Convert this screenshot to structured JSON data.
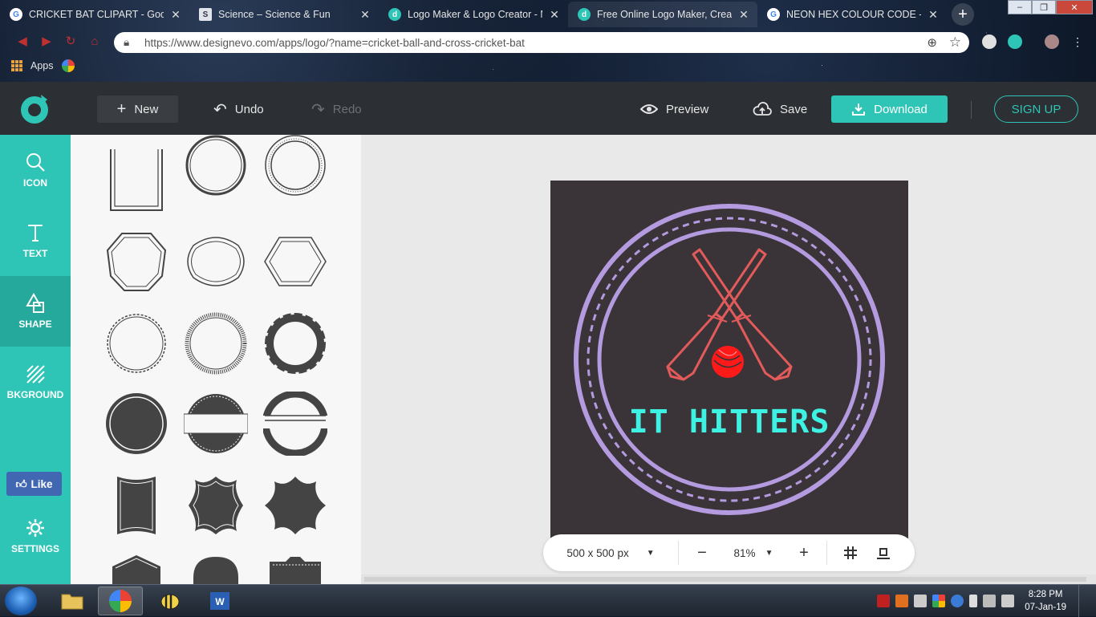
{
  "browser": {
    "tabs": [
      {
        "title": "CRICKET BAT CLIPART - Google",
        "favicon": "google-icon"
      },
      {
        "title": "Science – Science & Fun",
        "favicon": "science-icon"
      },
      {
        "title": "Logo Maker & Logo Creator - M",
        "favicon": "designevo-icon"
      },
      {
        "title": "Free Online Logo Maker, Create",
        "favicon": "designevo-icon"
      },
      {
        "title": "NEON HEX COLOUR CODE - Go",
        "favicon": "google-icon"
      }
    ],
    "url": "https://www.designevo.com/apps/logo/?name=cricket-ball-and-cross-cricket-bat",
    "bookmarks": {
      "apps_label": "Apps"
    }
  },
  "toolbar": {
    "new_label": "New",
    "undo_label": "Undo",
    "redo_label": "Redo",
    "preview_label": "Preview",
    "save_label": "Save",
    "download_label": "Download",
    "signup_label": "SIGN UP"
  },
  "sidebar": {
    "items": [
      {
        "label": "ICON",
        "icon": "search-icon"
      },
      {
        "label": "TEXT",
        "icon": "text-icon"
      },
      {
        "label": "SHAPE",
        "icon": "shape-icon"
      },
      {
        "label": "BKGROUND",
        "icon": "background-icon"
      },
      {
        "label": "SETTINGS",
        "icon": "gear-icon"
      }
    ],
    "active": "SHAPE",
    "like_label": "Like"
  },
  "canvas": {
    "logo_text": "IT HITTERS",
    "size_label": "500 x 500 px",
    "zoom_label": "81%",
    "colors": {
      "background": "#3a3438",
      "ring": "#b49be0",
      "bats": "#e35a5a",
      "ball": "#ff1a1a",
      "text": "#3ef2e3"
    }
  },
  "taskbar": {
    "time": "8:28 PM",
    "date": "07-Jan-19"
  }
}
